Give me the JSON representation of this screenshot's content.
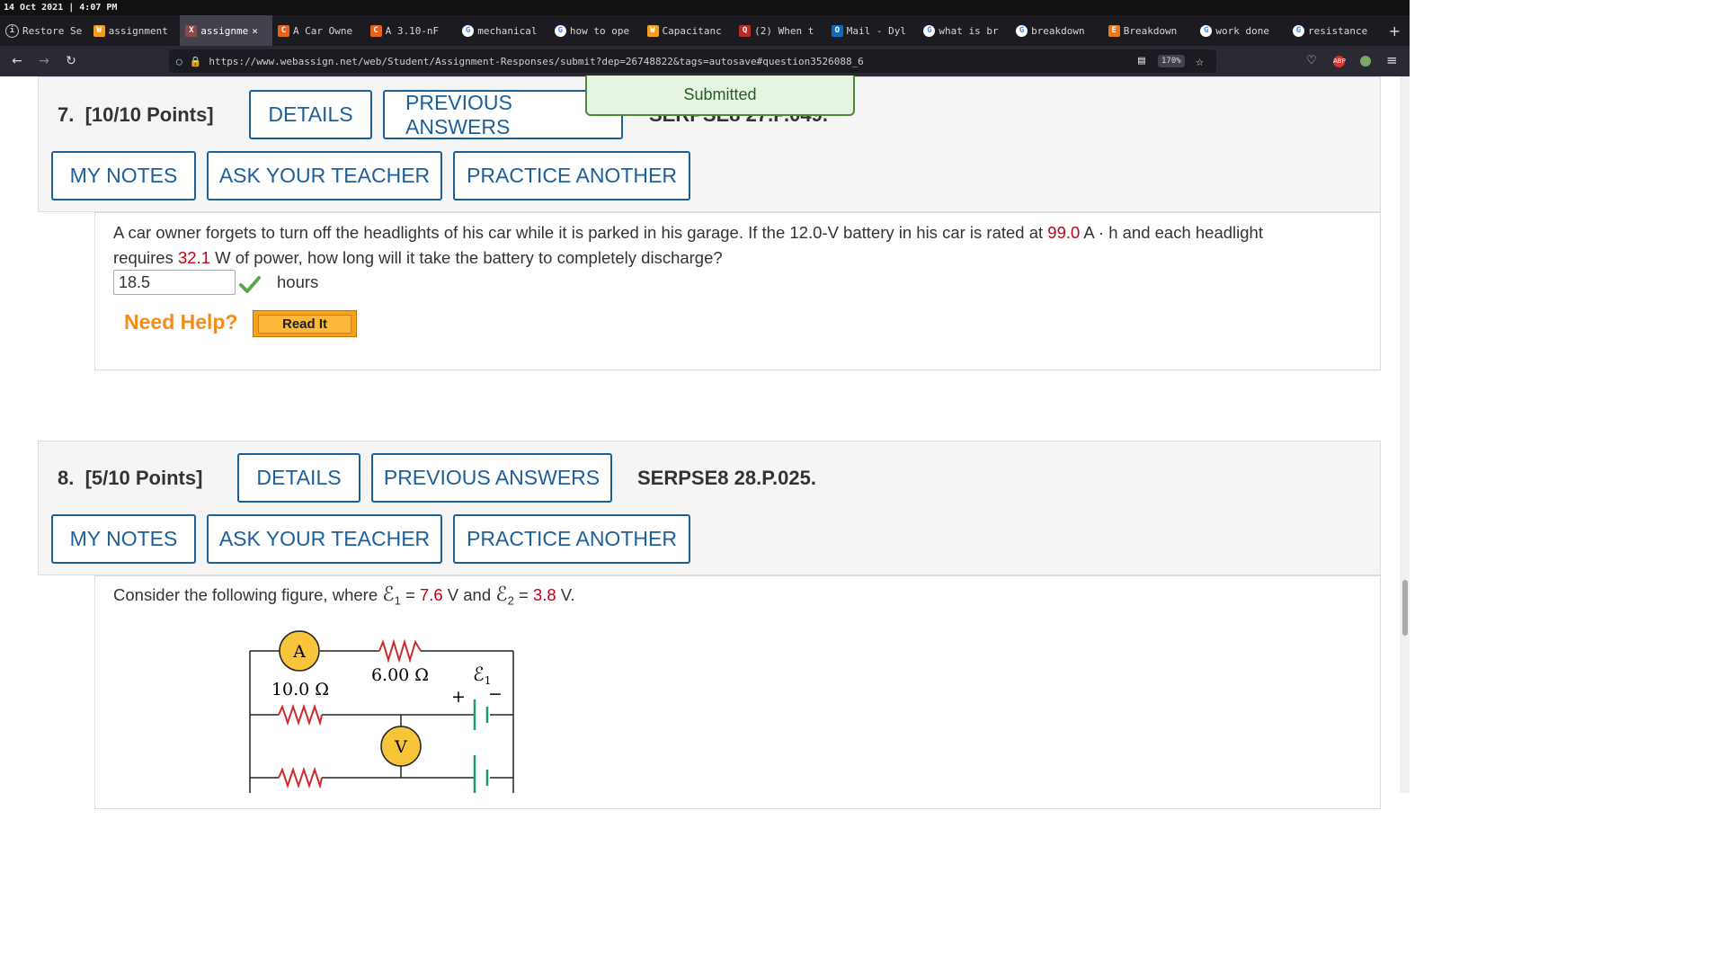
{
  "datebar": {
    "text": "14 Oct 2021 | 4:07 PM"
  },
  "tabs": [
    {
      "label": "Restore Se",
      "icon": "info-icon"
    },
    {
      "label": "assignment",
      "icon": "W"
    },
    {
      "label": "assignme",
      "icon": "X",
      "active": true
    },
    {
      "label": "A Car Owne",
      "icon": "C"
    },
    {
      "label": "A 3.10-nF",
      "icon": "C"
    },
    {
      "label": "mechanical",
      "icon": "G"
    },
    {
      "label": "how to ope",
      "icon": "G"
    },
    {
      "label": "Capacitanc",
      "icon": "W"
    },
    {
      "label": "(2) When t",
      "icon": "Q"
    },
    {
      "label": "Mail - Dyl",
      "icon": "O"
    },
    {
      "label": "what is br",
      "icon": "G"
    },
    {
      "label": "breakdown",
      "icon": "G"
    },
    {
      "label": "Breakdown",
      "icon": "E"
    },
    {
      "label": "work done",
      "icon": "G"
    },
    {
      "label": "resistance",
      "icon": "G"
    }
  ],
  "navbar": {
    "url": "https://www.webassign.net/web/Student/Assignment-Responses/submit?dep=26748822&tags=autosave#question3526088_6",
    "zoom": "170%"
  },
  "toast": {
    "text": "Submitted"
  },
  "q7": {
    "number": "7.",
    "points": "[10/10 Points]",
    "details": "DETAILS",
    "previous": "PREVIOUS ANSWERS",
    "ref": "SERPSE8 27.P.049.",
    "my_notes": "MY NOTES",
    "ask_teacher": "ASK YOUR TEACHER",
    "practice": "PRACTICE ANOTHER",
    "text_a": "A car owner forgets to turn off the headlights of his car while it is parked in his garage. If the 12.0-V battery in his car is rated at ",
    "val_capacity": "99.0",
    "text_b": " A · h and each headlight",
    "text_c": "requires ",
    "val_power": "32.1",
    "text_d": " W of power, how long will it take the battery to completely discharge?",
    "answer": "18.5",
    "unit": "hours",
    "need_help": "Need Help?",
    "read_it": "Read It"
  },
  "q8": {
    "number": "8.",
    "points": "[5/10 Points]",
    "details": "DETAILS",
    "previous": "PREVIOUS ANSWERS",
    "ref": "SERPSE8 28.P.025.",
    "my_notes": "MY NOTES",
    "ask_teacher": "ASK YOUR TEACHER",
    "practice": "PRACTICE ANOTHER",
    "text_a": "Consider the following figure, where ",
    "eps1_sym": "ℰ",
    "eps1_sub": "1",
    "eq1": " = ",
    "val_e1": "7.6",
    "text_b": " V and ",
    "eps2_sym": "ℰ",
    "eps2_sub": "2",
    "eq2": " = ",
    "val_e2": "3.8",
    "text_c": " V.",
    "figure": {
      "ammeter": "A",
      "voltmeter": "V",
      "r1": "10.0 Ω",
      "r2": "6.00 Ω",
      "emf_label": "ℰ",
      "emf_sub": "1",
      "plus": "+",
      "minus": "−"
    }
  }
}
